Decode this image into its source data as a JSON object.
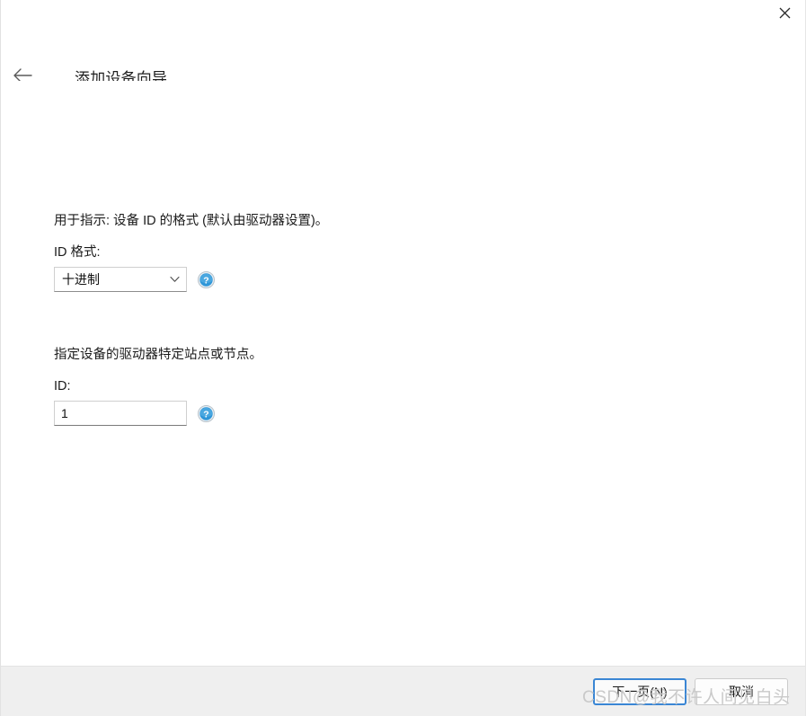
{
  "window": {
    "close_label": "✕",
    "close_icon": "close-icon"
  },
  "header": {
    "back_icon": "arrow-left-icon",
    "title": "添加设备向导"
  },
  "main": {
    "sections": [
      {
        "description": "用于指示: 设备 ID 的格式 (默认由驱动器设置)。",
        "field_label": "ID 格式:",
        "control": "combobox",
        "value": "十进制",
        "options": [
          "十进制"
        ],
        "dropdown_icon": "chevron-down-icon",
        "help_icon": "help-circle-icon"
      },
      {
        "description": "指定设备的驱动器特定站点或节点。",
        "field_label": "ID:",
        "control": "textinput",
        "value": "1",
        "placeholder": "",
        "help_icon": "help-circle-icon"
      }
    ]
  },
  "footer": {
    "next_label": "下一页(N)",
    "cancel_label": "取消"
  },
  "watermark": {
    "text": "CSDN@我不许人间见白头"
  },
  "colors": {
    "accent": "#3a86d4",
    "help_blue": "#2f96d8",
    "footer_bg": "#efefef",
    "text": "#1a1a1a",
    "watermark": "#c9c9c9"
  }
}
